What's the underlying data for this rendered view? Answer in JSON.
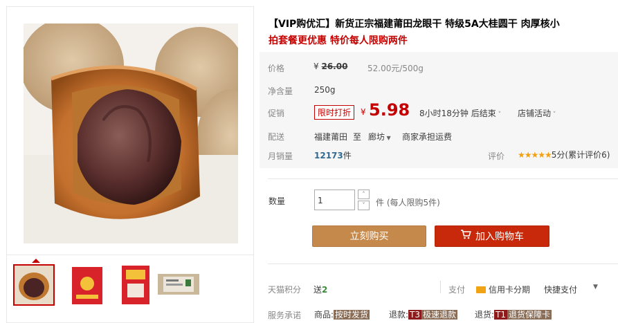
{
  "product": {
    "title": "【VIP购优汇】新货正宗福建莆田龙眼干 特级5A大桂圆干 肉厚核小",
    "subtitle": "拍套餐更优惠 特价每人限购两件"
  },
  "price": {
    "label": "价格",
    "currency": "¥",
    "original": "26.00",
    "unit_price": "52.00元/500g"
  },
  "weight": {
    "label": "净含量",
    "value": "250g"
  },
  "promo": {
    "label": "促销",
    "tag": "限时打折",
    "currency": "¥",
    "price": "5.98",
    "countdown": "8小时18分钟 后结束",
    "shop_activity": "店铺活动"
  },
  "delivery": {
    "label": "配送",
    "from": "福建莆田",
    "to_word": "至",
    "to": "廊坊",
    "shipping": "商家承担运费"
  },
  "sales": {
    "label": "月销量",
    "count": "12173",
    "unit": "件",
    "rating_label": "评价",
    "stars": "★★★★★",
    "rating": "5分(累计评价6)"
  },
  "quantity": {
    "label": "数量",
    "value": "1",
    "note": "件 (每人限购5件)",
    "up": "˄",
    "down": "˅"
  },
  "buttons": {
    "buy": "立刻购买",
    "cart": "加入购物车"
  },
  "points": {
    "label": "天猫积分",
    "send_word": "送",
    "value": "2",
    "pay_label": "支付",
    "credit": "信用卡分期",
    "quick": "快捷支付"
  },
  "service": {
    "label": "服务承诺",
    "item1_prefix": "商品:",
    "item1_badge": "按时发货",
    "item2_prefix": "退款:",
    "item2_badge": "T3",
    "item2_text": "极速退款",
    "item3_prefix": "退货:",
    "item3_badge": "T1",
    "item3_text": "退货保障卡"
  },
  "colors": {
    "accent": "#c40000",
    "buy": "#c5894c",
    "cart": "#c8290b",
    "star": "#f3a00e"
  }
}
